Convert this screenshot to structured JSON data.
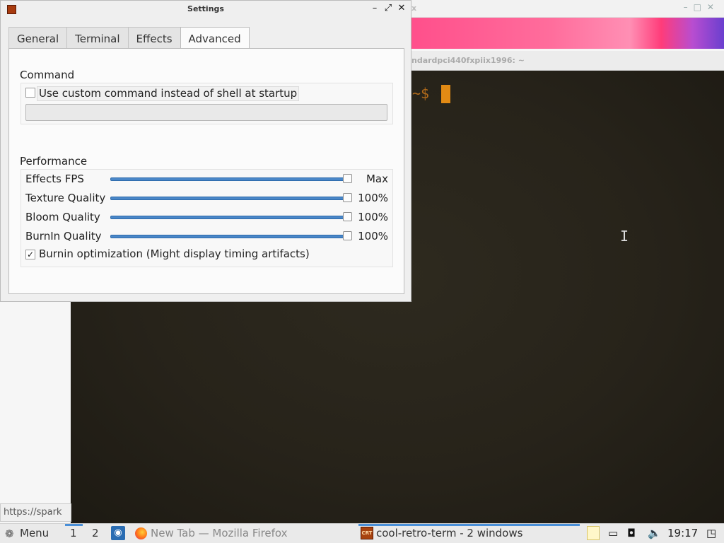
{
  "background": {
    "firefox_title": "x",
    "terminal_title": "ndardpci440fxpiix1996: ~",
    "terminal_prompt": "~$",
    "status_url": "https://spark"
  },
  "dialog": {
    "title": "Settings",
    "tabs": [
      {
        "label": "General"
      },
      {
        "label": "Terminal"
      },
      {
        "label": "Effects"
      },
      {
        "label": "Advanced",
        "active": true
      }
    ],
    "command": {
      "section_title": "Command",
      "custom_command_checkbox": {
        "label": "Use custom command instead of shell at startup",
        "checked": false
      },
      "command_input": {
        "value": "",
        "placeholder": ""
      }
    },
    "performance": {
      "section_title": "Performance",
      "rows": [
        {
          "label": "Effects FPS",
          "value": "Max",
          "level": 1.0
        },
        {
          "label": "Texture Quality",
          "value": "100%",
          "level": 1.0
        },
        {
          "label": "Bloom Quality",
          "value": "100%",
          "level": 1.0
        },
        {
          "label": "BurnIn Quality",
          "value": "100%",
          "level": 1.0
        }
      ],
      "burnin_optimization": {
        "label": "Burnin optimization (Might display timing artifacts)",
        "checked": true
      }
    }
  },
  "taskbar": {
    "menu_label": "Menu",
    "workspaces": [
      "1",
      "2"
    ],
    "tasks": [
      {
        "label": "New Tab — Mozilla Firefox",
        "icon": "firefox-icon"
      },
      {
        "label": "cool-retro-term - 2 windows",
        "icon": "cool-retro-term-icon",
        "active": true
      }
    ],
    "clock": "19:17"
  },
  "colors": {
    "accent": "#4a87c8",
    "terminal_amber": "#e28a14"
  }
}
